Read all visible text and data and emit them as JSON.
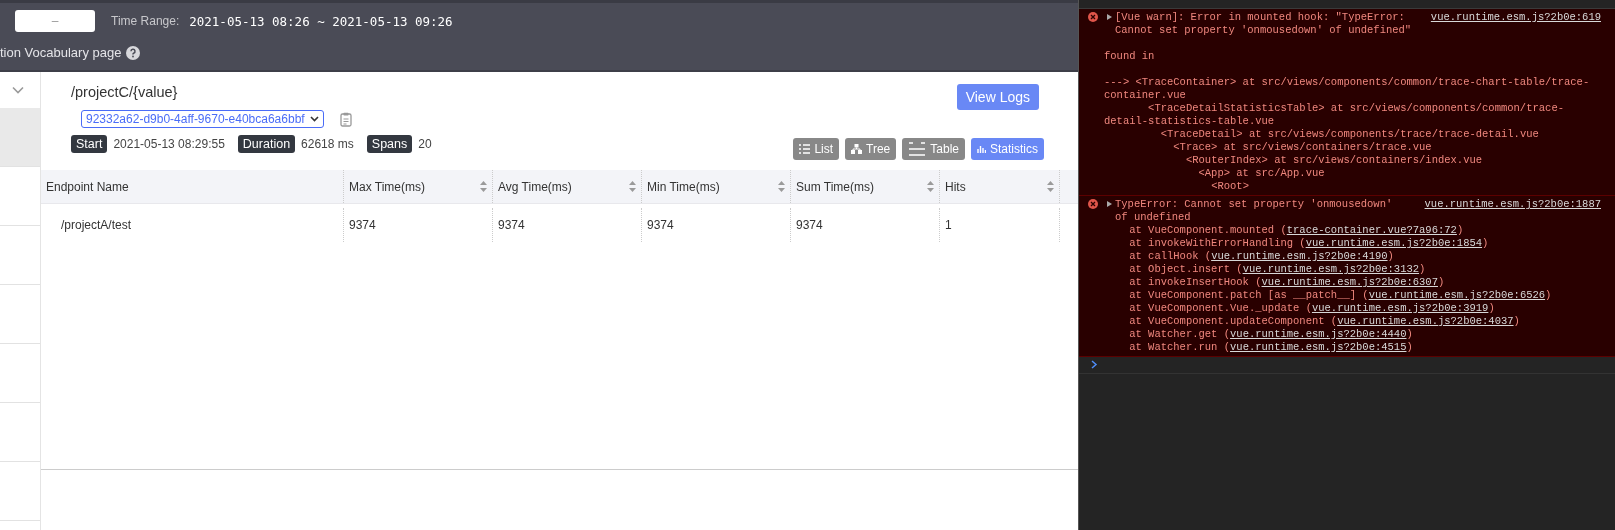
{
  "header": {
    "date_field": {
      "placeholder": "–"
    },
    "time_range": {
      "label": "Time Range:",
      "value": "2021-05-13 08:26 ~ 2021-05-13 09:26"
    },
    "hint": {
      "text": "tion Vocabulary page"
    }
  },
  "trace": {
    "endpoint": "/projectC/{value}",
    "trace_id": "92332a62-d9b0-4aff-9670-e40bca6a6bbf",
    "view_logs": "View Logs",
    "meta": [
      {
        "label": "Start",
        "value": "2021-05-13 08:29:55"
      },
      {
        "label": "Duration",
        "value": "62618 ms"
      },
      {
        "label": "Spans",
        "value": "20"
      }
    ],
    "views": [
      {
        "label": "List",
        "kind": "list",
        "selected": false
      },
      {
        "label": "Tree",
        "kind": "tree",
        "selected": false
      },
      {
        "label": "Table",
        "kind": "table",
        "selected": false
      },
      {
        "label": "Statistics",
        "kind": "chart",
        "selected": true
      }
    ]
  },
  "table": {
    "columns": [
      {
        "label": "Endpoint Name",
        "sortable": false
      },
      {
        "label": "Max Time(ms)",
        "sortable": true
      },
      {
        "label": "Avg Time(ms)",
        "sortable": true
      },
      {
        "label": "Min Time(ms)",
        "sortable": true
      },
      {
        "label": "Sum Time(ms)",
        "sortable": true
      },
      {
        "label": "Hits",
        "sortable": true
      }
    ],
    "rows": [
      [
        "/projectA/test",
        "9374",
        "9374",
        "9374",
        "9374",
        "1"
      ]
    ]
  },
  "console": {
    "messages": [
      {
        "kind": "error",
        "text": "[Vue warn]: Error in mounted hook: \"TypeError: Cannot set property 'onmousedown' of undefined\"",
        "link": "vue.runtime.esm.js?2b0e:619",
        "details": "found in\n\n---> <TraceContainer> at src/views/components/common/trace-chart-table/trace-container.vue\n       <TraceDetailStatisticsTable> at src/views/components/common/trace-detail-statistics-table.vue\n         <TraceDetail> at src/views/components/trace/trace-detail.vue\n           <Trace> at src/views/containers/trace.vue\n             <RouterIndex> at src/views/containers/index.vue\n               <App> at src/App.vue\n                 <Root>"
      },
      {
        "kind": "error",
        "text": "TypeError: Cannot set property 'onmousedown' of undefined",
        "link": "vue.runtime.esm.js?2b0e:1887",
        "frames": [
          {
            "prefix": "at VueComponent.mounted (",
            "link": "trace-container.vue?7a96:72",
            "suffix": ")"
          },
          {
            "prefix": "at invokeWithErrorHandling (",
            "link": "vue.runtime.esm.js?2b0e:1854",
            "suffix": ")"
          },
          {
            "prefix": "at callHook (",
            "link": "vue.runtime.esm.js?2b0e:4190",
            "suffix": ")"
          },
          {
            "prefix": "at Object.insert (",
            "link": "vue.runtime.esm.js?2b0e:3132",
            "suffix": ")"
          },
          {
            "prefix": "at invokeInsertHook (",
            "link": "vue.runtime.esm.js?2b0e:6307",
            "suffix": ")"
          },
          {
            "prefix": "at VueComponent.patch [as __patch__] (",
            "link": "vue.runtime.esm.js?2b0e:6526",
            "suffix": ")"
          },
          {
            "prefix": "at VueComponent.Vue._update (",
            "link": "vue.runtime.esm.js?2b0e:3919",
            "suffix": ")"
          },
          {
            "prefix": "at VueComponent.updateComponent (",
            "link": "vue.runtime.esm.js?2b0e:4037",
            "suffix": ")"
          },
          {
            "prefix": "at Watcher.get (",
            "link": "vue.runtime.esm.js?2b0e:4440",
            "suffix": ")"
          },
          {
            "prefix": "at Watcher.run (",
            "link": "vue.runtime.esm.js?2b0e:4515",
            "suffix": ")"
          }
        ]
      }
    ]
  }
}
